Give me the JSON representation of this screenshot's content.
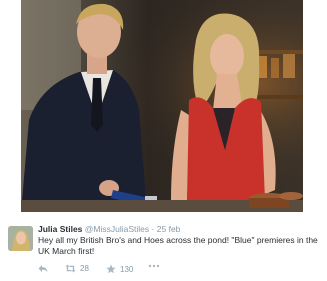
{
  "tweet": {
    "author_name": "Julia Stiles",
    "author_handle": "@MissJuliaStiles",
    "separator": "·",
    "date": "25 feb",
    "text": "Hey all my British Bro's and Hoes across the pond! \"Blue\" premieres in the UK March first!",
    "actions": {
      "reply_icon": "reply-icon",
      "retweet_icon": "retweet-icon",
      "retweet_count": "28",
      "favorite_icon": "star-icon",
      "favorite_count": "130",
      "more_icon": "more-dots-icon"
    }
  },
  "colors": {
    "name": "#292f33",
    "meta": "#8899a6",
    "text": "#292f33",
    "action_icons": "#aab8c2",
    "dress": "#c8322a"
  }
}
